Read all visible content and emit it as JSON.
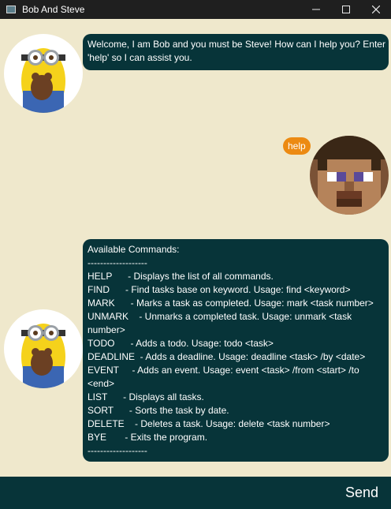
{
  "window": {
    "title": "Bob And Steve",
    "controls": [
      "minimize-icon",
      "maximize-icon",
      "close-icon"
    ]
  },
  "messages": {
    "welcome": {
      "lines": [
        "Welcome, I am Bob and you must be Steve! How can I help you? Enter",
        "'help' so I can assist you."
      ]
    },
    "user": {
      "text": "help"
    },
    "commands": {
      "lines": [
        "Available Commands:",
        "-------------------",
        "HELP      - Displays the list of all commands.",
        "FIND      - Find tasks base on keyword. Usage: find <keyword>",
        "MARK      - Marks a task as completed. Usage: mark <task number>",
        "UNMARK    - Unmarks a completed task. Usage: unmark <task",
        "number>",
        "TODO      - Adds a todo. Usage: todo <task>",
        "DEADLINE  - Adds a deadline. Usage: deadline <task> /by <date>",
        "EVENT     - Adds an event. Usage: event <task> /from <start> /to",
        "<end>",
        "LIST      - Displays all tasks.",
        "SORT      - Sorts the task by date.",
        "DELETE    - Deletes a task. Usage: delete <task number>",
        "BYE       - Exits the program.",
        "-------------------"
      ]
    }
  },
  "input": {
    "value": "",
    "placeholder": ""
  },
  "send_button": {
    "label": "Send"
  },
  "colors": {
    "background": "#efe8cc",
    "bot_bubble": "#073439",
    "user_bubble": "#ec8a12",
    "titlebar": "#1f1f1f"
  }
}
